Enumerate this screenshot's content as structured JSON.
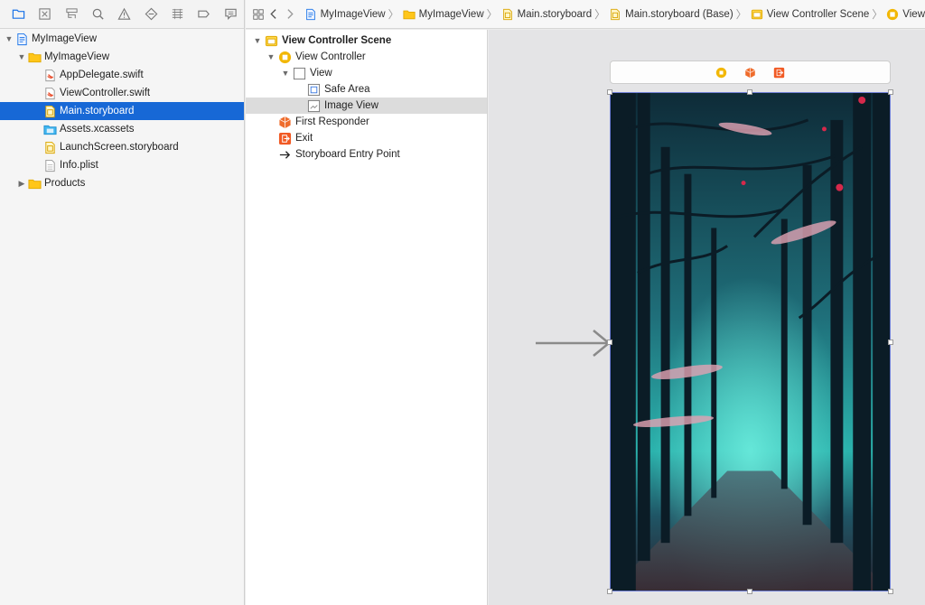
{
  "navigator": {
    "toolbar_icons": [
      "folder-icon",
      "source-control-icon",
      "symbol-icon",
      "find-icon",
      "issue-icon",
      "test-icon",
      "debug-icon",
      "breakpoint-icon",
      "report-icon"
    ],
    "items": [
      {
        "label": "MyImageView",
        "icon": "project-icon",
        "depth": 0,
        "expanded": true
      },
      {
        "label": "MyImageView",
        "icon": "group-folder-icon",
        "depth": 1,
        "expanded": true
      },
      {
        "label": "AppDelegate.swift",
        "icon": "swift-file-icon",
        "depth": 2
      },
      {
        "label": "ViewController.swift",
        "icon": "swift-file-icon",
        "depth": 2
      },
      {
        "label": "Main.storyboard",
        "icon": "storyboard-file-icon",
        "depth": 2,
        "selected": true
      },
      {
        "label": "Assets.xcassets",
        "icon": "assets-icon",
        "depth": 2
      },
      {
        "label": "LaunchScreen.storyboard",
        "icon": "storyboard-file-icon",
        "depth": 2
      },
      {
        "label": "Info.plist",
        "icon": "plist-file-icon",
        "depth": 2
      },
      {
        "label": "Products",
        "icon": "group-folder-icon",
        "depth": 1,
        "expanded": false
      }
    ]
  },
  "jumpbar": {
    "crumbs": [
      {
        "label": "MyImageView",
        "icon": "project-icon"
      },
      {
        "label": "MyImageView",
        "icon": "group-folder-icon"
      },
      {
        "label": "Main.storyboard",
        "icon": "storyboard-file-icon"
      },
      {
        "label": "Main.storyboard (Base)",
        "icon": "storyboard-file-icon"
      },
      {
        "label": "View Controller Scene",
        "icon": "scene-icon"
      },
      {
        "label": "View",
        "icon": "view-controller-icon"
      }
    ]
  },
  "outline": {
    "scene_title": "View Controller Scene",
    "view_controller": "View Controller",
    "view": "View",
    "safe_area": "Safe Area",
    "image_view": "Image View",
    "first_responder": "First Responder",
    "exit": "Exit",
    "entry_point": "Storyboard Entry Point"
  },
  "colors": {
    "selection": "#1768d6",
    "scene_yellow": "#f2b705",
    "responder_orange": "#ef6c2c",
    "exit_orange": "#f15a24",
    "frame_blue": "#6f7fd6"
  }
}
